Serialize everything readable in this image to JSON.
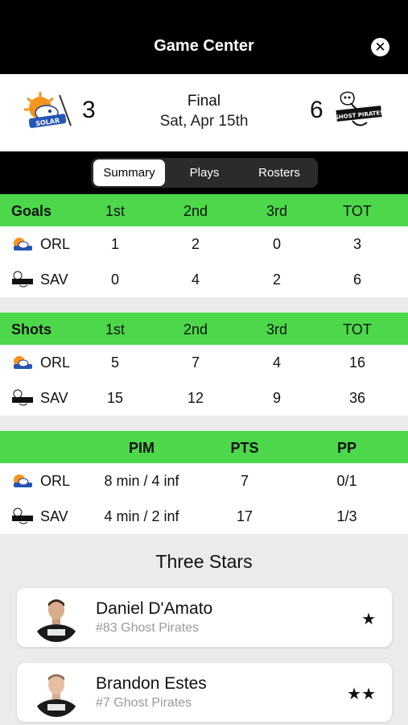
{
  "header": {
    "title": "Game Center",
    "close_icon": "close-icon"
  },
  "scoreboard": {
    "home": {
      "abbr": "ORL",
      "score": "3",
      "logo": "orlando-solar-bears-logo"
    },
    "away": {
      "abbr": "SAV",
      "score": "6",
      "logo": "savannah-ghost-pirates-logo"
    },
    "status": "Final",
    "date": "Sat, Apr 15th"
  },
  "tabs": [
    {
      "label": "Summary",
      "active": true
    },
    {
      "label": "Plays",
      "active": false
    },
    {
      "label": "Rosters",
      "active": false
    }
  ],
  "goals": {
    "title": "Goals",
    "columns": [
      "1st",
      "2nd",
      "3rd",
      "TOT"
    ],
    "rows": [
      {
        "team": "ORL",
        "values": [
          "1",
          "2",
          "0",
          "3"
        ]
      },
      {
        "team": "SAV",
        "values": [
          "0",
          "4",
          "2",
          "6"
        ]
      }
    ]
  },
  "shots": {
    "title": "Shots",
    "columns": [
      "1st",
      "2nd",
      "3rd",
      "TOT"
    ],
    "rows": [
      {
        "team": "ORL",
        "values": [
          "5",
          "7",
          "4",
          "16"
        ]
      },
      {
        "team": "SAV",
        "values": [
          "15",
          "12",
          "9",
          "36"
        ]
      }
    ]
  },
  "misc": {
    "columns": [
      "PIM",
      "PTS",
      "PP"
    ],
    "rows": [
      {
        "team": "ORL",
        "values": [
          "8 min / 4 inf",
          "7",
          "0/1"
        ]
      },
      {
        "team": "SAV",
        "values": [
          "4 min / 2 inf",
          "17",
          "1/3"
        ]
      }
    ]
  },
  "three_stars": {
    "title": "Three Stars",
    "players": [
      {
        "name": "Daniel D'Amato",
        "info": "#83 Ghost Pirates",
        "stars": "★"
      },
      {
        "name": "Brandon Estes",
        "info": "#7 Ghost Pirates",
        "stars": "★★"
      }
    ]
  },
  "colors": {
    "header_bg": "#000000",
    "table_header": "#4cd84a",
    "page_bg": "#ebebeb"
  }
}
